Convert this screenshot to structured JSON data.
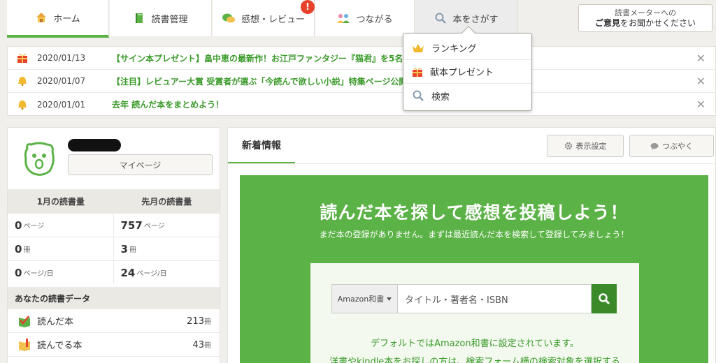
{
  "nav": {
    "tabs": [
      {
        "label": "ホーム",
        "icon": "house-icon"
      },
      {
        "label": "読書管理",
        "icon": "book-icon"
      },
      {
        "label": "感想・レビュー",
        "icon": "speech-bubble-icon",
        "badge": "!"
      },
      {
        "label": "つながる",
        "icon": "people-icon"
      },
      {
        "label": "本をさがす",
        "icon": "magnifier-icon"
      }
    ],
    "opinion_line1": "読書メーターへの",
    "opinion_line2_bold": "ご意見",
    "opinion_line2_rest": "をお聞かせください"
  },
  "notices": [
    {
      "date": "2020/01/13",
      "text": "【サイン本プレゼント】畠中恵の最新作！お江戸ファンタジー『猫君』を5名",
      "icon": "gift-icon",
      "close": "✕"
    },
    {
      "date": "2020/01/07",
      "text": "【注目】レビュアー大賞 受賞者が選ぶ「今読んで欲しい小説」特集ページ公開",
      "icon": "bell-icon",
      "close": "✕"
    },
    {
      "date": "2020/01/01",
      "text": "去年 読んだ本をまとめよう！",
      "icon": "bell-icon",
      "close": "✕"
    }
  ],
  "search_menu": [
    {
      "label": "ランキング",
      "icon": "crown-icon"
    },
    {
      "label": "献本プレゼント",
      "icon": "gift-icon"
    },
    {
      "label": "検索",
      "icon": "magnifier-icon"
    }
  ],
  "profile": {
    "mypage_label": "マイページ"
  },
  "stats": {
    "this_month_label": "1月の読書量",
    "last_month_label": "先月の読書量",
    "rows": [
      {
        "a_num": "0",
        "a_unit": "ページ",
        "b_num": "757",
        "b_unit": "ページ"
      },
      {
        "a_num": "0",
        "a_unit": "冊",
        "b_num": "3",
        "b_unit": "冊"
      },
      {
        "a_num": "0",
        "a_unit": "ページ/日",
        "b_num": "24",
        "b_unit": "ページ/日"
      }
    ]
  },
  "reading_data": {
    "title": "あなたの読書データ",
    "items": [
      {
        "label": "読んだ本",
        "count": "213",
        "unit": "冊",
        "icon": "read-book-icon"
      },
      {
        "label": "読んでる本",
        "count": "43",
        "unit": "冊",
        "icon": "reading-book-icon"
      }
    ]
  },
  "news": {
    "tab_label": "新着情報",
    "display_settings": "表示設定",
    "tweet": "つぶやく"
  },
  "hero": {
    "title": "読んだ本を探して感想を投稿しよう！",
    "subtitle": "まだ本の登録がありません。まずは最近読んだ本を検索して登録してみましょう！",
    "select_value": "Amazon和書",
    "placeholder": "タイトル・著者名・ISBN",
    "note1": "デフォルトではAmazon和書に設定されています。",
    "note2": "洋書やkindle本をお探しの方は、検索フォーム横の検索対象を選択する"
  },
  "colors": {
    "accent": "#5bb246",
    "dark_green": "#3a8a2a",
    "badge": "#e8412c"
  }
}
